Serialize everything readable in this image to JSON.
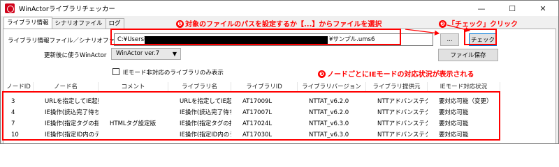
{
  "window": {
    "title": "WinActorライブラリチェッカー",
    "minimize": "—",
    "maximize": "☐",
    "close": "✕"
  },
  "tabs": [
    "ライブラリ情報",
    "シナリオファイル",
    "ログ"
  ],
  "form": {
    "path_label": "ライブラリ情報ファイル／シナリオファイル",
    "path_prefix": "C:¥Users¥",
    "path_suffix": "¥サンプル.ums6",
    "browse_button": "...",
    "check_button": "チェック",
    "winactor_label": "更新後に使うWinActor",
    "winactor_select": "WinActor ver.7",
    "save_button": "ファイル保存",
    "ie_checkbox_label": "IEモード非対応のライブラリのみ表示",
    "ie_checkbox_checked": false
  },
  "table": {
    "columns": [
      "ノードID",
      "ノード名",
      "コメント",
      "ライブラリ名",
      "ライブラリID",
      "ライブラリバージョン",
      "ライブラリ提供元",
      "IEモード対応状況"
    ],
    "rows": [
      [
        "3",
        "URLを指定してIE起動",
        "",
        "URLを指定してIE起動",
        "AT17009L",
        "NTTAT_v6.2.0",
        "NTTアドバンステクノロジ",
        "要対応可能（変更）"
      ],
      [
        "4",
        "IE操作(読込完了待ち)",
        "",
        "IE操作(読込完了待ち)",
        "AT17007L",
        "NTTAT_v6.2.0",
        "NTTアドバンステクノロジ",
        "要対応可能"
      ],
      [
        "7",
        "IE操作(指定タグの指定",
        "HTMLタグ設定版",
        "IE操作(指定タグの指定",
        "AT17024L",
        "NTTAT_v6.3.0",
        "NTTアドバンステクノロジ",
        "要対応可能"
      ],
      [
        "10",
        "IE操作(指定ID内のテキ",
        "",
        "IE操作(指定ID内のテキ",
        "AT17030L",
        "NTTAT_v6.3.0",
        "NTTアドバンステクノロジ",
        "要対応可能"
      ]
    ]
  },
  "annotations": {
    "a1_num": "❶",
    "a1_text": "対象のファイルのパスを設定するか【...】からファイルを選択",
    "a2_num": "❷",
    "a2_text": "「チェック」クリック",
    "a3_num": "❸",
    "a3_text": "ノードごとにIEモードの対応状況が表示される"
  },
  "colors": {
    "annotation": "#ff0000",
    "titlebar": "#ffffff",
    "panel": "#f0f0f0",
    "focus_border": "#0078d7"
  }
}
